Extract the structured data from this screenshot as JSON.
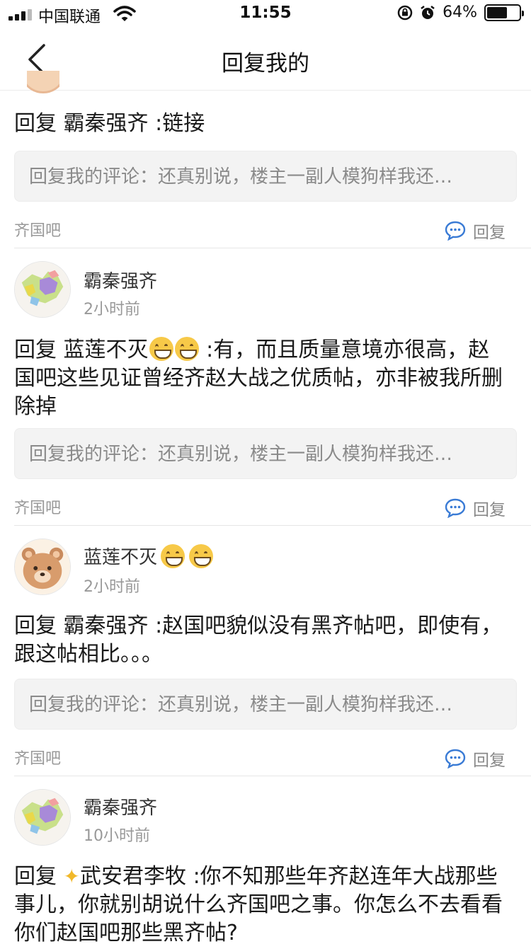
{
  "status_bar": {
    "carrier": "中国联通",
    "time": "11:55",
    "battery_percent": "64%",
    "battery_level": 0.64
  },
  "nav": {
    "title": "回复我的",
    "back_icon": "chevron-left-icon"
  },
  "items": [
    {
      "content_prefix": "回复",
      "content_target": "霸秦强齐",
      "content_text": ":链接",
      "quote": "回复我的评论：还真别说，楼主一副人模狗样我还…",
      "forum": "齐国吧",
      "reply_label": "回复"
    },
    {
      "username": "霸秦强齐",
      "time": "2小时前",
      "content_prefix": "回复",
      "content_target": "蓝莲不灭",
      "content_text": ":有，而且质量意境亦很高，赵国吧这些见证曾经齐赵大战之优质帖，亦非被我所删除掉",
      "quote": "回复我的评论：还真别说，楼主一副人模狗样我还…",
      "forum": "齐国吧",
      "reply_label": "回复"
    },
    {
      "username": "蓝莲不灭",
      "time": "2小时前",
      "content_prefix": "回复",
      "content_target": "霸秦强齐",
      "content_text": ":赵国吧貌似没有黑齐帖吧，即使有，跟这帖相比。。。",
      "quote": "回复我的评论：还真别说，楼主一副人模狗样我还…",
      "forum": "齐国吧",
      "reply_label": "回复"
    },
    {
      "username": "霸秦强齐",
      "time": "10小时前",
      "content_prefix": "回复",
      "content_target": "武安君李牧",
      "content_text": ":你不知那些年齐赵连年大战那些事儿，你就别胡说什么齐国吧之事。你怎么不去看看你们赵国吧那些黑齐帖?"
    }
  ],
  "colors": {
    "accent_blue": "#3a7bd5",
    "quote_bg": "#f3f3f3",
    "meta_gray": "#999999"
  }
}
